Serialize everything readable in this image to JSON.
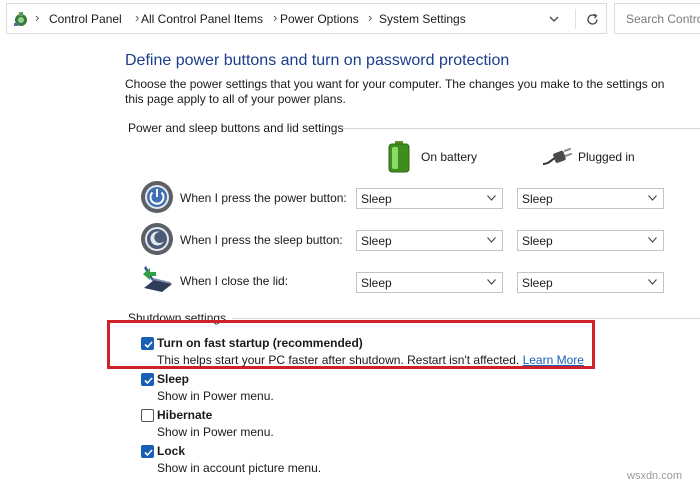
{
  "breadcrumb": {
    "items": [
      "Control Panel",
      "All Control Panel Items",
      "Power Options",
      "System Settings"
    ]
  },
  "search": {
    "placeholder": "Search Control Panel"
  },
  "page": {
    "title": "Define power buttons and turn on password protection",
    "description": "Choose the power settings that you want for your computer. The changes you make to the settings on this page apply to all of your power plans."
  },
  "buttons_section": {
    "heading": "Power and sleep buttons and lid settings",
    "on_battery": "On battery",
    "plugged_in": "Plugged in",
    "rows": [
      {
        "label": "When I press the power button:",
        "battery": "Sleep",
        "plugged": "Sleep",
        "icon": "power-button-icon"
      },
      {
        "label": "When I press the sleep button:",
        "battery": "Sleep",
        "plugged": "Sleep",
        "icon": "sleep-button-icon"
      },
      {
        "label": "When I close the lid:",
        "battery": "Sleep",
        "plugged": "Sleep",
        "icon": "laptop-lid-icon"
      }
    ]
  },
  "shutdown": {
    "heading": "Shutdown settings",
    "options": [
      {
        "label": "Turn on fast startup (recommended)",
        "sub": "This helps start your PC faster after shutdown. Restart isn't affected.",
        "link": "Learn More",
        "checked": true
      },
      {
        "label": "Sleep",
        "sub": "Show in Power menu.",
        "checked": true
      },
      {
        "label": "Hibernate",
        "sub": "Show in Power menu.",
        "checked": false
      },
      {
        "label": "Lock",
        "sub": "Show in account picture menu.",
        "checked": true
      }
    ]
  },
  "watermark": "wsxdn.com",
  "colors": {
    "title": "#1a3e8c",
    "checkbox": "#1a5fb4",
    "highlight": "#d0202a",
    "link": "#1a5fb4"
  }
}
